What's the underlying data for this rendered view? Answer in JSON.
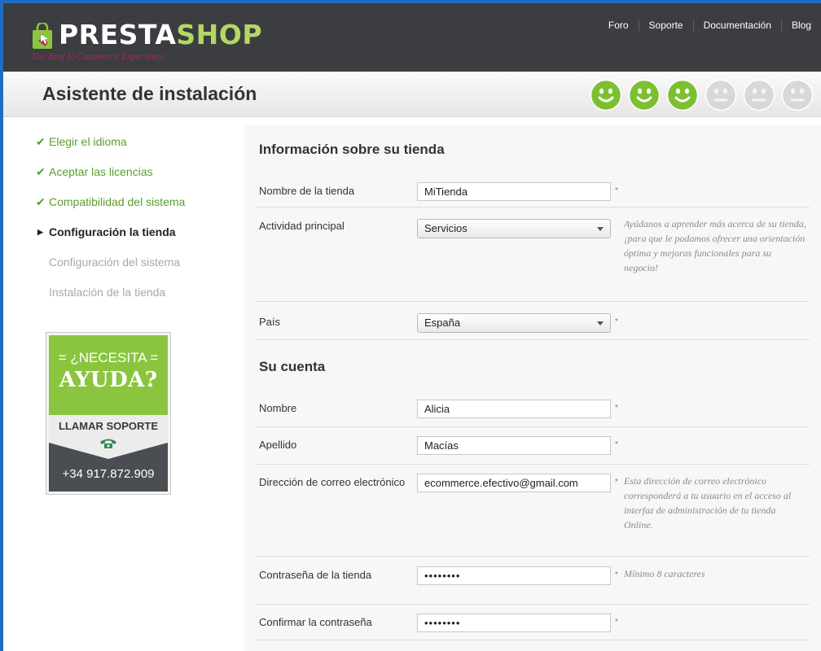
{
  "header": {
    "logo_word_1": "PRESTA",
    "logo_word_2": "SHOP",
    "tagline": "The Best E-Commerce Experience",
    "nav": [
      "Foro",
      "Soporte",
      "Documentación",
      "Blog"
    ]
  },
  "title": "Asistente de instalación",
  "progress": {
    "completed_steps": 3,
    "total_steps": 6
  },
  "steps": [
    {
      "label": "Elegir el idioma",
      "state": "done"
    },
    {
      "label": "Aceptar las licencias",
      "state": "done"
    },
    {
      "label": "Compatibilidad del sistema",
      "state": "done"
    },
    {
      "label": "Configuración la tienda",
      "state": "current"
    },
    {
      "label": "Configuración del sistema",
      "state": "todo"
    },
    {
      "label": "Instalación de la tienda",
      "state": "todo"
    }
  ],
  "help": {
    "line1": "= ¿NECESITA =",
    "line2": "AYUDA?",
    "call": "LLAMAR SOPORTE",
    "phone": "+34 917.872.909"
  },
  "store_section": {
    "title": "Información sobre su tienda",
    "store_name_label": "Nombre de la tienda",
    "store_name_value": "MiTienda",
    "activity_label": "Actividad principal",
    "activity_value": "Servicios",
    "activity_hint": "Ayúdanos a aprender más acerca de su tienda, ¡para que le podamos ofrecer una orientación óptima y mejoras funcionales para su negocio!",
    "country_label": "País",
    "country_value": "España"
  },
  "account_section": {
    "title": "Su cuenta",
    "first_name_label": "Nombre",
    "first_name_value": "Alicia",
    "last_name_label": "Apellido",
    "last_name_value": "Macías",
    "email_label": "Dirección de correo electrónico",
    "email_value": "ecommerce.efectivo@gmail.com",
    "email_hint": "Esta dirección de correo electrónico corresponderá a tu usuario en el acceso al interfaz de administración de tu tienda Online.",
    "password_label": "Contraseña de la tienda",
    "password_value": "••••••••",
    "password_hint": "Mínimo 8 caracteres",
    "confirm_label": "Confirmar la contraseña",
    "confirm_value": "••••••••"
  },
  "required_mark": "*",
  "colors": {
    "brand_green": "#8bc53f",
    "smiley_active": "#7cc031",
    "smiley_inactive": "#d8d8d8",
    "header_bg": "#3b3d40",
    "done_text": "#5a9e2a"
  }
}
